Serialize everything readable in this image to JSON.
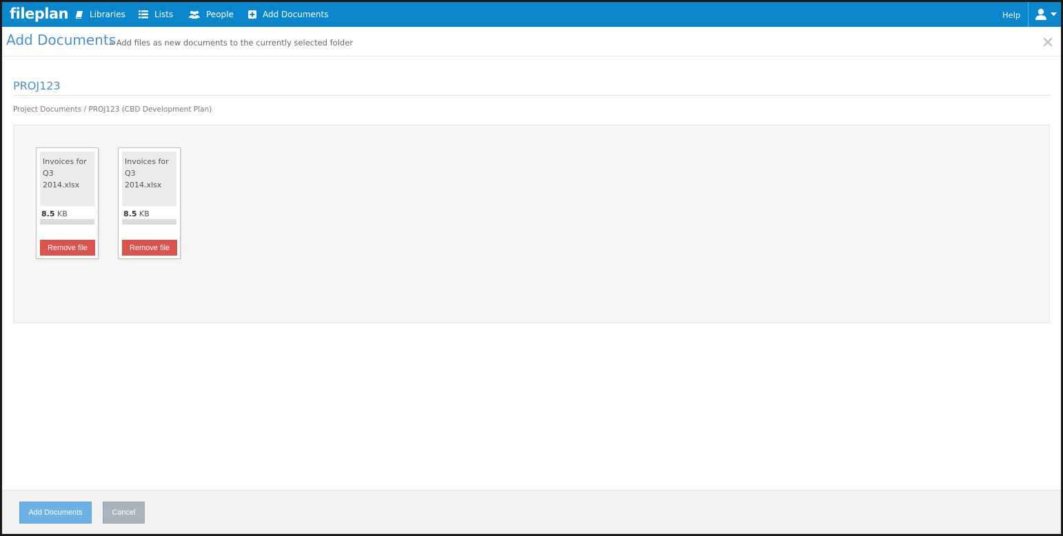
{
  "topbar": {
    "logo": "fileplan",
    "nav": [
      {
        "label": "Libraries",
        "icon": "book-icon"
      },
      {
        "label": "Lists",
        "icon": "list-icon"
      },
      {
        "label": "People",
        "icon": "people-icon"
      },
      {
        "label": "Add Documents",
        "icon": "plus-square-icon"
      }
    ],
    "help": "Help",
    "user_icon": "user-icon",
    "accent": "#0a86cc"
  },
  "header": {
    "title": "Add Documents",
    "subtitle": "» Add files as new documents to the currently selected folder"
  },
  "folder": {
    "name": "PROJ123",
    "breadcrumb": "Project Documents / PROJ123 (CBD Development Plan)"
  },
  "files": [
    {
      "name": "Invoices for Q3 2014.xlsx",
      "size_value": "8.5",
      "size_unit": "KB",
      "progress": 0,
      "remove_label": "Remove file"
    },
    {
      "name": "Invoices for Q3 2014.xlsx",
      "size_value": "8.5",
      "size_unit": "KB",
      "progress": 0,
      "remove_label": "Remove file"
    }
  ],
  "footer": {
    "submit_label": "Add Documents",
    "cancel_label": "Cancel"
  }
}
